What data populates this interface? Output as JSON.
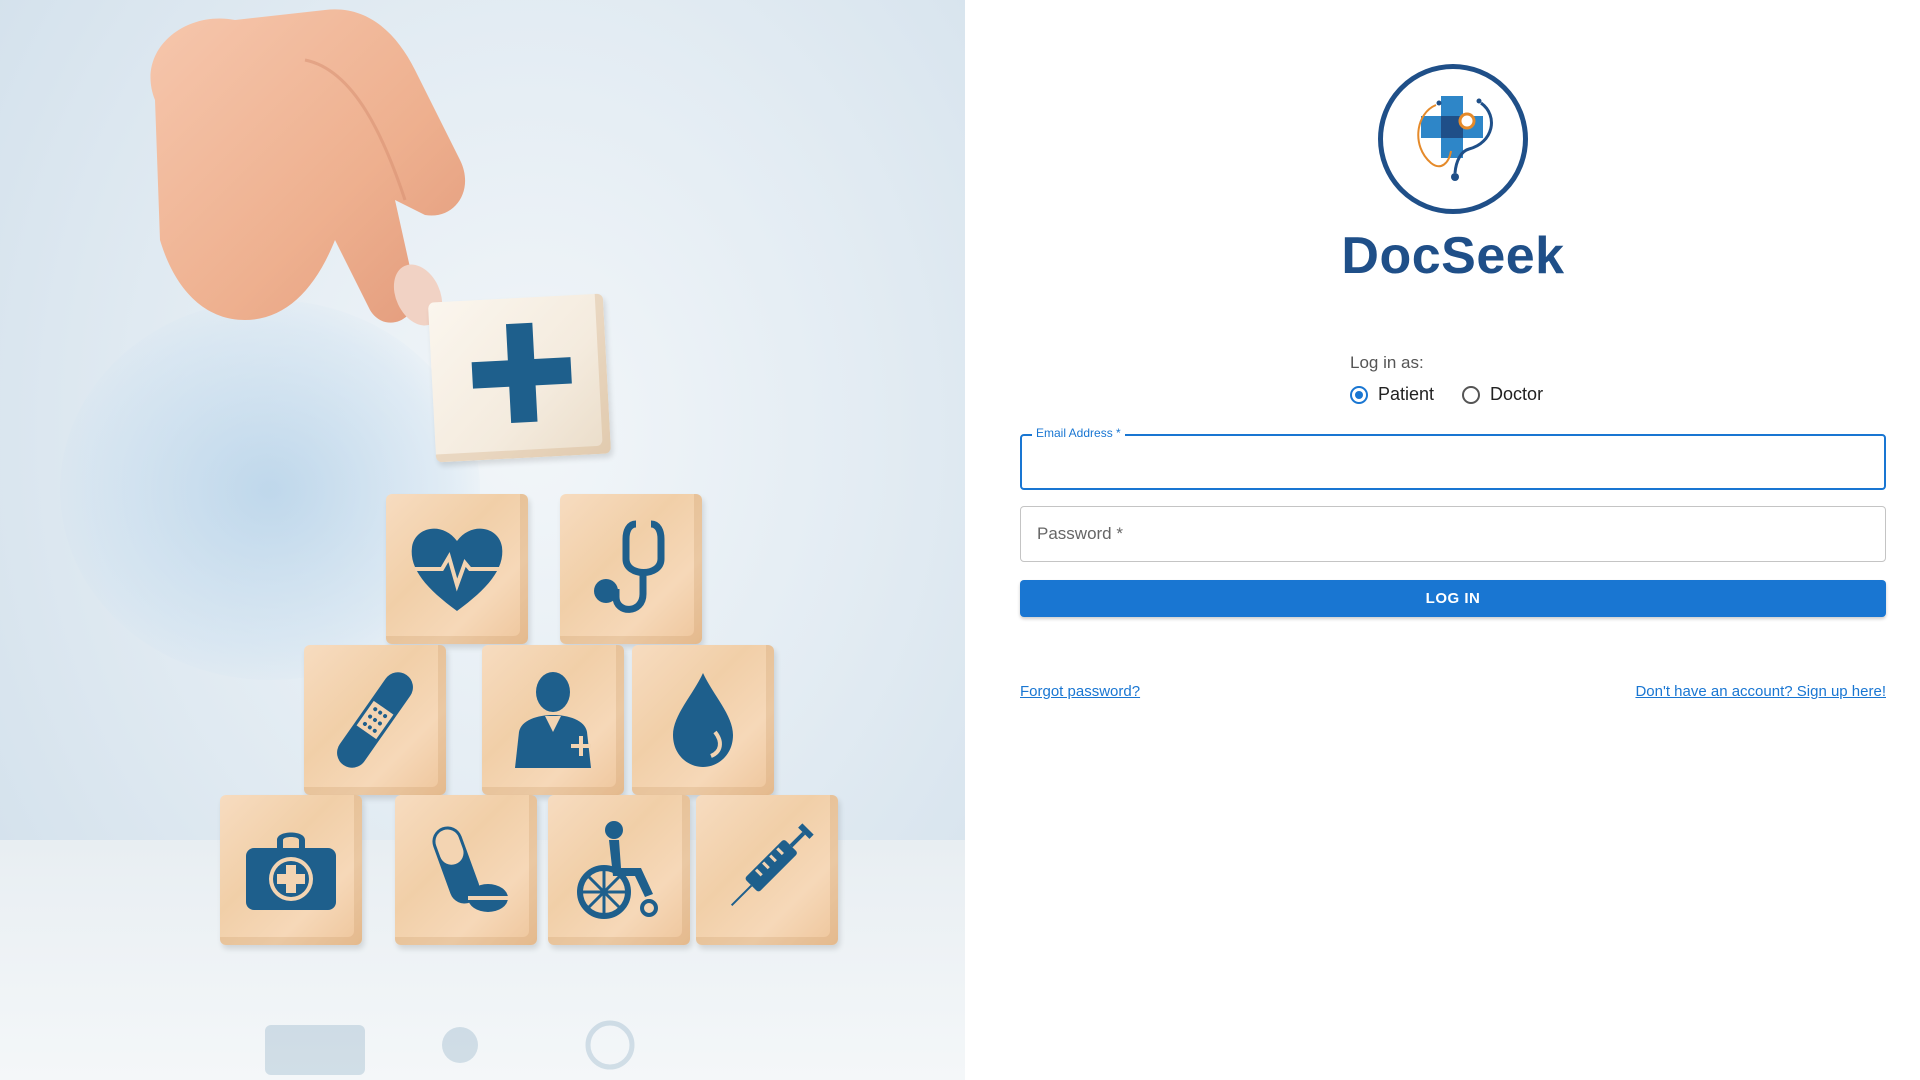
{
  "brand": {
    "name": "DocSeek",
    "color": "#1f4f88"
  },
  "login": {
    "prompt": "Log in as:",
    "roles": [
      {
        "label": "Patient",
        "selected": true
      },
      {
        "label": "Doctor",
        "selected": false
      }
    ],
    "email": {
      "label": "Email Address *",
      "value": ""
    },
    "password": {
      "placeholder": "Password *",
      "value": ""
    },
    "submit_label": "LOG IN",
    "forgot_label": "Forgot password?",
    "signup_label": "Don't have an account? Sign up here!"
  },
  "colors": {
    "accent": "#1976d2",
    "icon": "#1e5f8c",
    "wood": "#f3d4b2"
  },
  "hero": {
    "icons": [
      "plus-icon",
      "heart-pulse-icon",
      "stethoscope-icon",
      "bandage-icon",
      "doctor-icon",
      "blood-drop-icon",
      "first-aid-kit-icon",
      "pill-icon",
      "wheelchair-icon",
      "syringe-icon"
    ]
  }
}
